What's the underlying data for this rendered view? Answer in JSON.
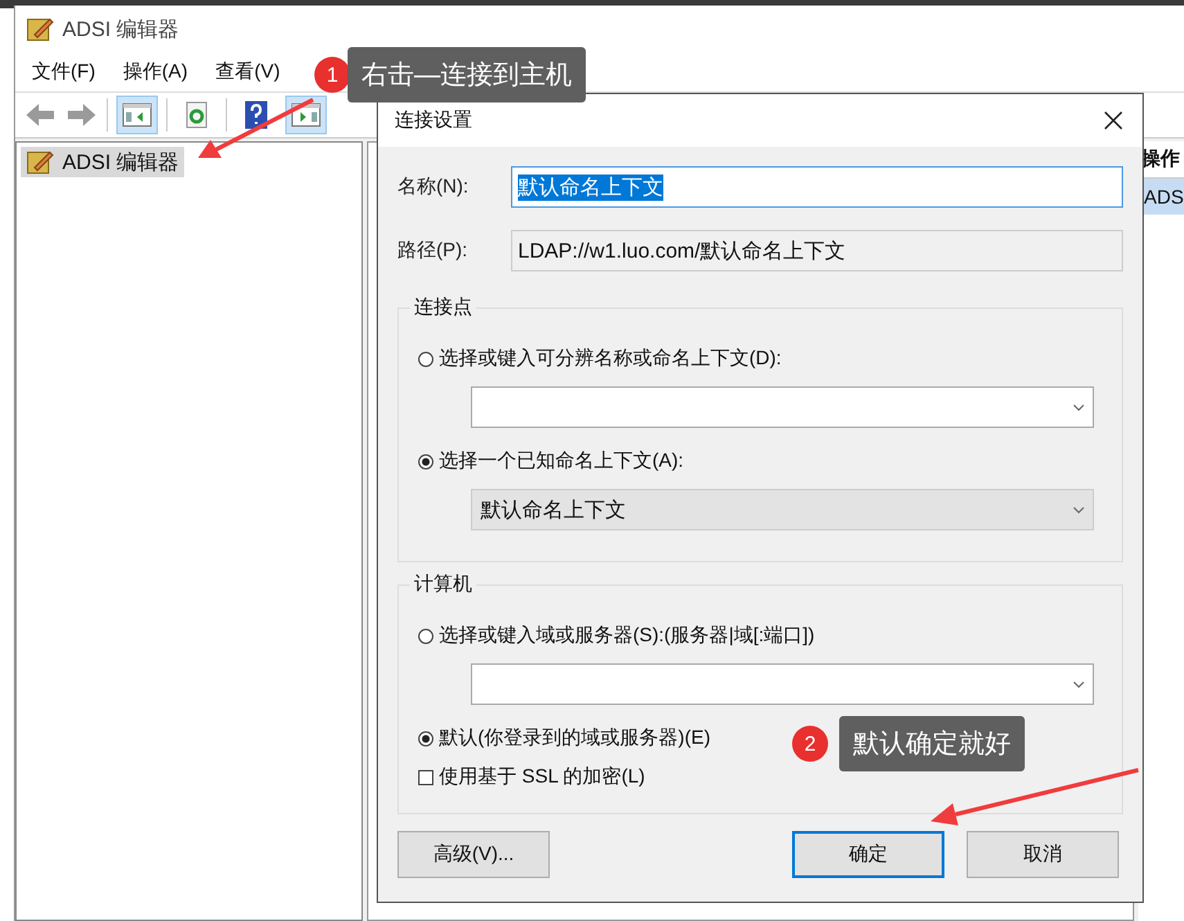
{
  "window": {
    "title": "ADSI 编辑器"
  },
  "menu": [
    {
      "label": "文件(F)"
    },
    {
      "label": "操作(A)"
    },
    {
      "label": "查看(V)"
    }
  ],
  "toolbar": [
    {
      "kind": "back"
    },
    {
      "kind": "forward"
    },
    {
      "kind": "separator"
    },
    {
      "kind": "show-tree",
      "selected": true
    },
    {
      "kind": "separator"
    },
    {
      "kind": "refresh",
      "selected": false
    },
    {
      "kind": "separator"
    },
    {
      "kind": "help",
      "selected": false
    },
    {
      "kind": "show-actions",
      "selected": true
    }
  ],
  "tree": [
    {
      "label": "ADSI 编辑器",
      "selected": true
    }
  ],
  "actions_pane": {
    "header": "操作",
    "items": [
      {
        "label": "ADS",
        "selected": true
      }
    ]
  },
  "dialog": {
    "title": "连接设置",
    "name_field": {
      "label": "名称(N):",
      "value": "默认命名上下文",
      "text_selected": true
    },
    "path_field": {
      "label": "路径(P):",
      "value": "LDAP://w1.luo.com/默认命名上下文",
      "disabled": true
    },
    "groups": [
      {
        "title": "连接点",
        "options": [
          {
            "kind": "radio",
            "label": "选择或键入可分辨名称或命名上下文(D):",
            "selected": false,
            "dropdown": {
              "disabled": false
            }
          },
          {
            "kind": "radio",
            "label": "选择一个已知命名上下文(A):",
            "selected": true,
            "dropdown": {
              "value": "默认命名上下文",
              "disabled": true
            }
          }
        ]
      },
      {
        "title": "计算机",
        "options": [
          {
            "kind": "radio",
            "label": "选择或键入域或服务器(S):(服务器|域[:端口])",
            "selected": false,
            "dropdown": {
              "disabled": false
            }
          },
          {
            "kind": "radio",
            "label": "默认(你登录到的域或服务器)(E)",
            "selected": true
          },
          {
            "kind": "checkbox",
            "label": "使用基于 SSL 的加密(L)",
            "checked": false
          }
        ]
      }
    ],
    "buttons": [
      {
        "label": "高级(V)...",
        "default": false
      },
      {
        "label": "确定",
        "default": true
      },
      {
        "label": "取消",
        "default": false
      }
    ]
  },
  "annotations": [
    {
      "number": "1",
      "text": "右击—连接到主机"
    },
    {
      "number": "2",
      "text": "默认确定就好"
    }
  ]
}
